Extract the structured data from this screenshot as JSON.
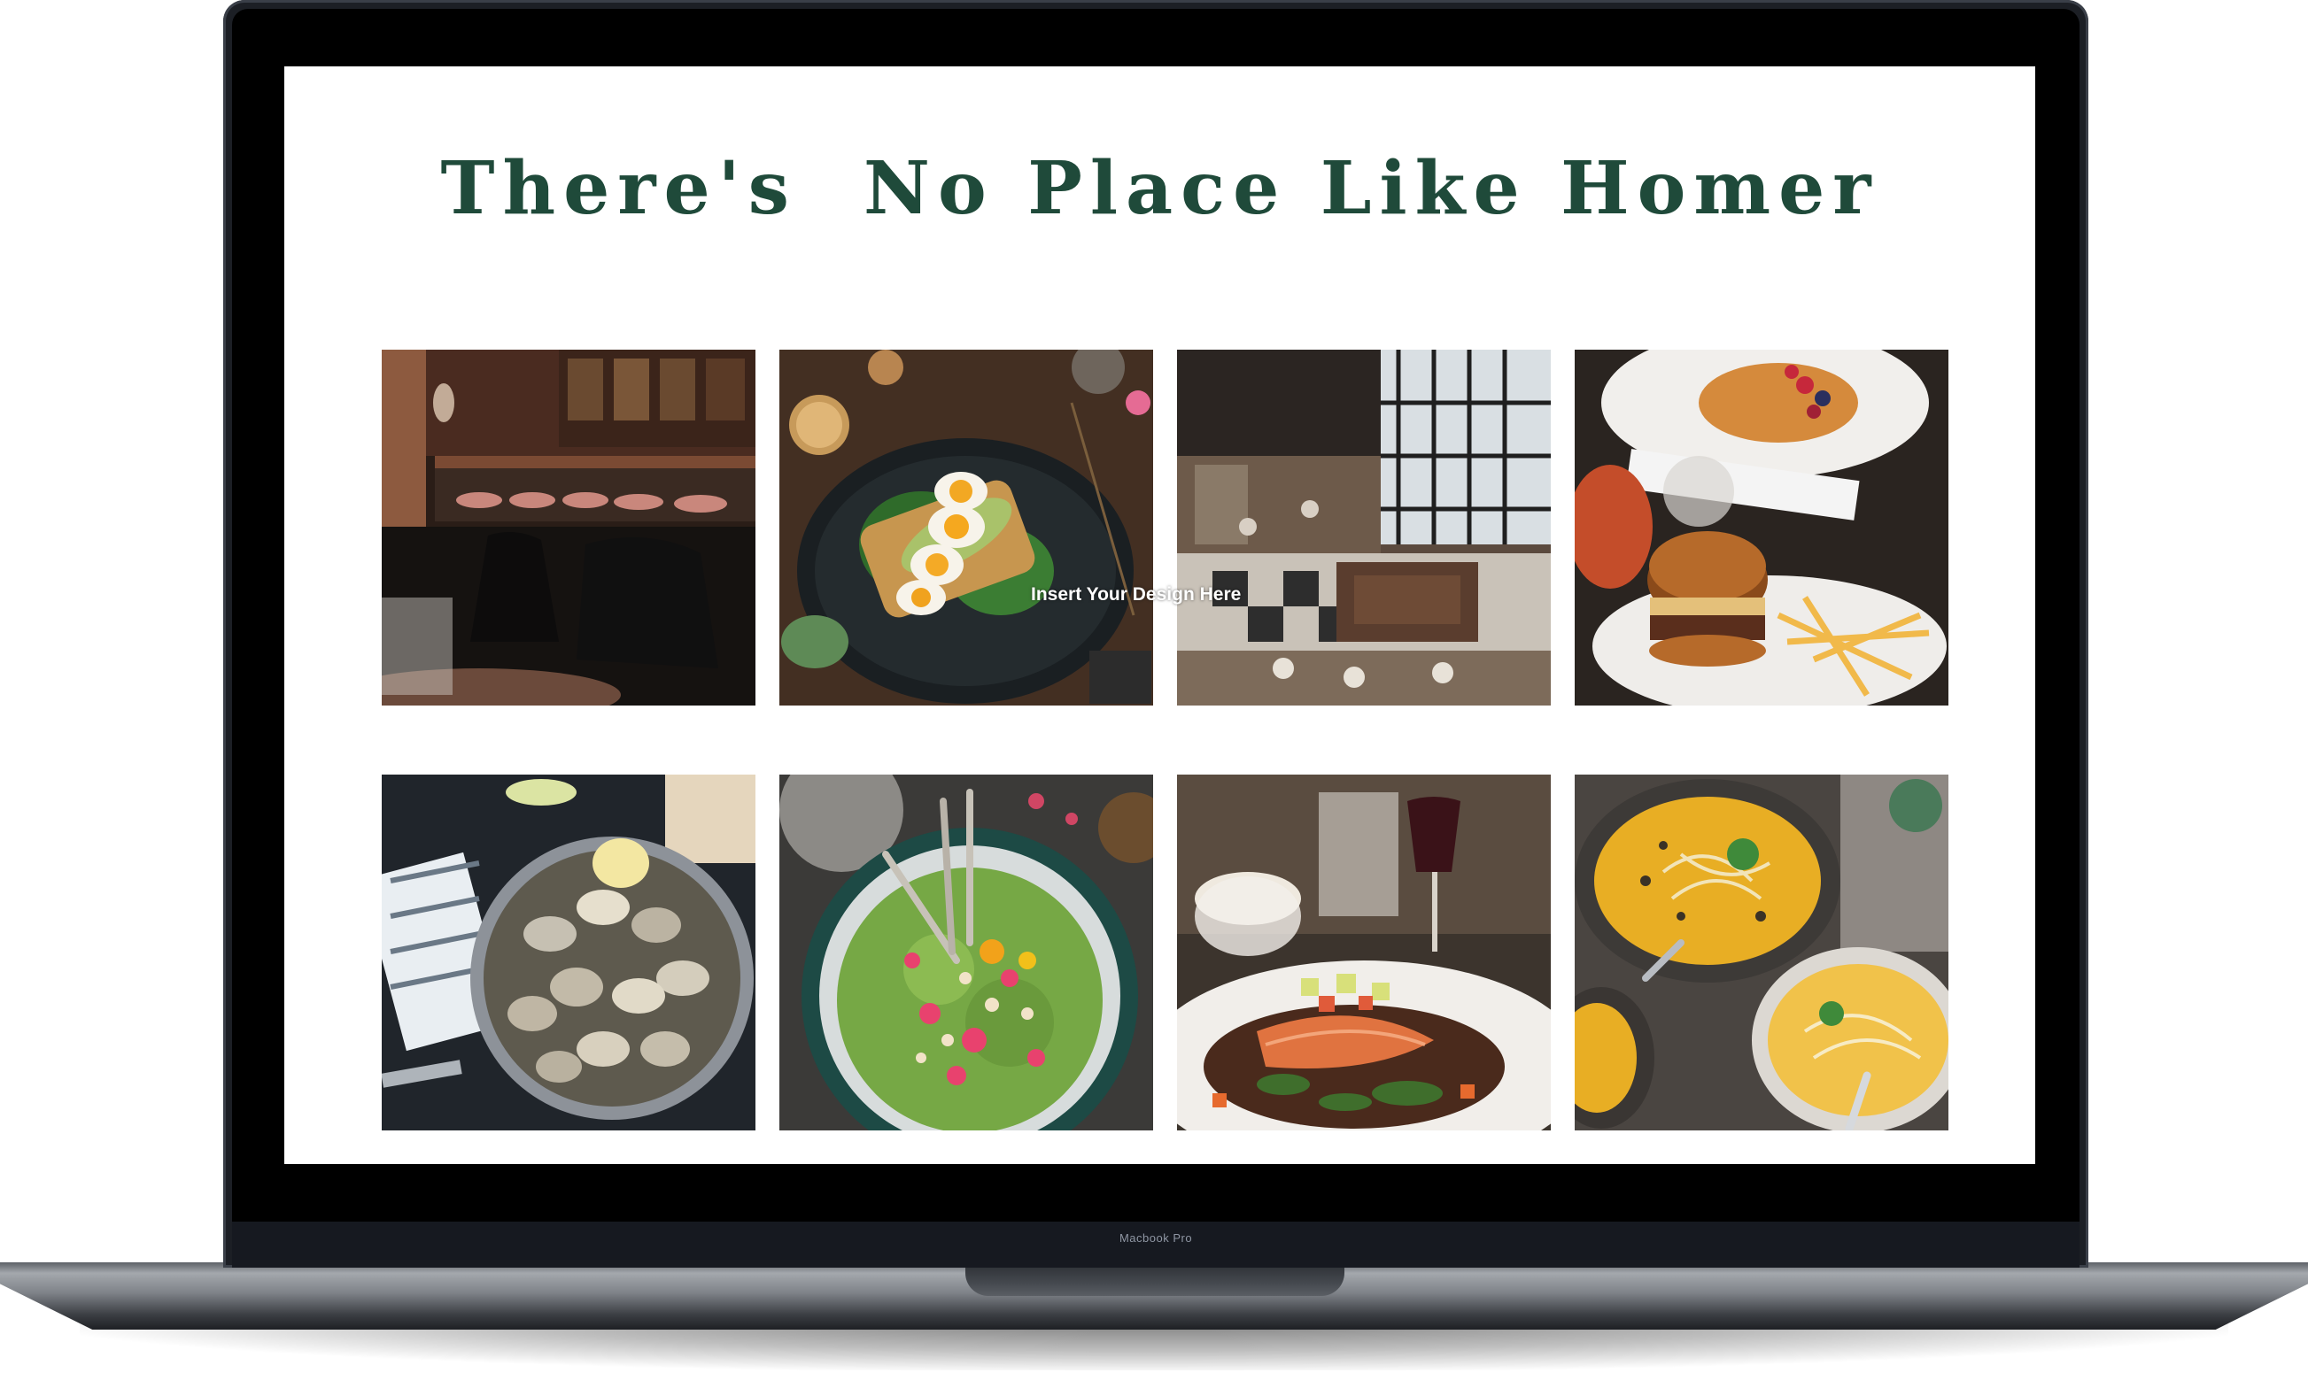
{
  "page": {
    "title": "There's  No Place Like Homer",
    "overlay_text": "Insert Your Design Here"
  },
  "device": {
    "model_label": "Macbook Pro"
  },
  "gallery": {
    "images": [
      {
        "subject": "restaurant bar interior with stools"
      },
      {
        "subject": "avocado toast with boiled eggs"
      },
      {
        "subject": "busy restaurant dining hall from above"
      },
      {
        "subject": "burger with fries and waffle plate"
      },
      {
        "subject": "pan of steamed clams"
      },
      {
        "subject": "green salad bowl with flowers"
      },
      {
        "subject": "grilled salmon with vegetables"
      },
      {
        "subject": "bowls of yellow soup with noodles"
      }
    ]
  },
  "colors": {
    "title": "#1f4a3a",
    "laptop_frame": "#1c1f25",
    "bezel": "#000000",
    "screen_bg": "#ffffff"
  }
}
